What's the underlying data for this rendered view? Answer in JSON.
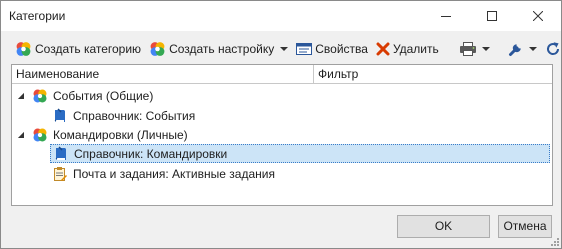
{
  "window": {
    "title": "Категории"
  },
  "toolbar": {
    "create_category": "Создать категорию",
    "create_setting": "Создать настройку",
    "properties": "Свойства",
    "delete": "Удалить"
  },
  "columns": {
    "name": "Наименование",
    "filter": "Фильтр"
  },
  "tree": {
    "items": [
      {
        "label": "События (Общие)",
        "icon": "category-icon",
        "expanded": true
      },
      {
        "label": "Справочник: События",
        "icon": "book-icon"
      },
      {
        "label": "Командировки (Личные)",
        "icon": "category-icon",
        "expanded": true
      },
      {
        "label": "Справочник: Командировки",
        "icon": "book-icon",
        "selected": true
      },
      {
        "label": "Почта и задания: Активные задания",
        "icon": "tasks-icon"
      }
    ]
  },
  "buttons": {
    "ok": "OK",
    "cancel": "Отмена"
  },
  "colors": {
    "selection": "#cce4f7",
    "selection_border": "#3a7cc8",
    "delete_red": "#d83b01"
  }
}
